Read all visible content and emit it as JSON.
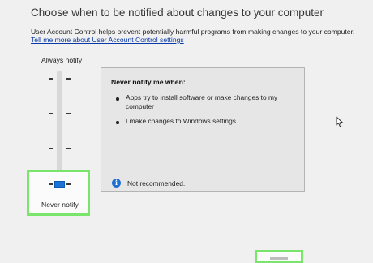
{
  "header": {
    "title": "Choose when to be notified about changes to your computer",
    "description": "User Account Control helps prevent potentially harmful programs from making changes to your computer.",
    "link": "Tell me more about User Account Control settings"
  },
  "slider": {
    "top_label": "Always notify",
    "bottom_label": "Never notify",
    "levels": 4,
    "selected_level": 1
  },
  "panel": {
    "heading": "Never notify me when:",
    "bullets": [
      "Apps try to install software or make changes to my computer",
      "I make changes to Windows settings"
    ],
    "info_text": "Not recommended.",
    "info_icon": "info-icon"
  },
  "colors": {
    "highlight": "#79e56b",
    "accent": "#1b74d3",
    "link": "#0a3aa8",
    "info": "#1f6fd0"
  },
  "icons": {
    "cursor": "mouse-pointer-icon"
  }
}
